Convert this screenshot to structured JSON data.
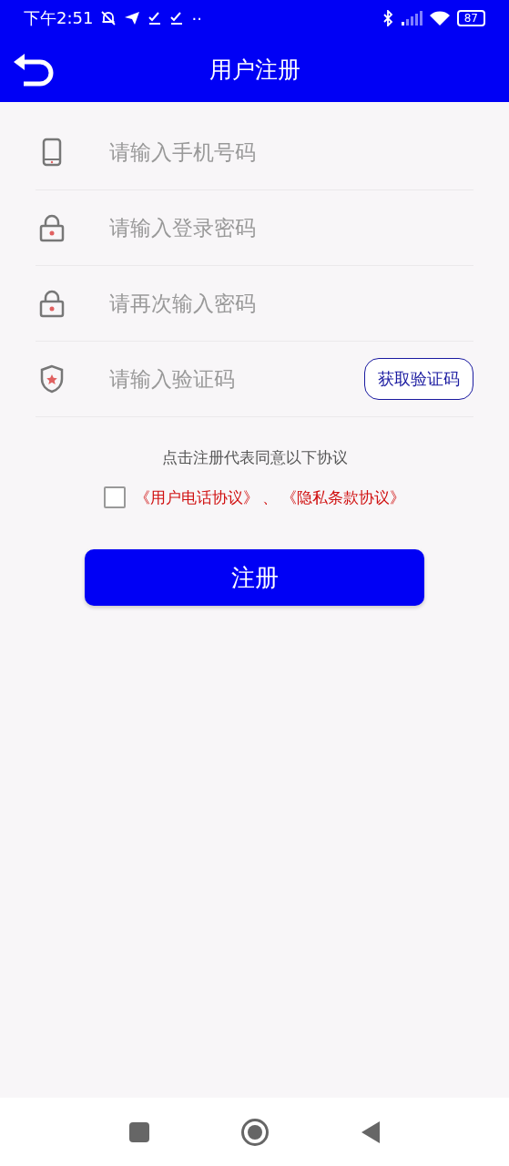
{
  "status_bar": {
    "time": "下午2:51",
    "dots": "··",
    "battery": "87"
  },
  "header": {
    "title": "用户注册"
  },
  "fields": [
    {
      "kind": "phone",
      "placeholder": "请输入手机号码"
    },
    {
      "kind": "lock",
      "placeholder": "请输入登录密码"
    },
    {
      "kind": "lock",
      "placeholder": "请再次输入密码"
    },
    {
      "kind": "shield",
      "placeholder": "请输入验证码",
      "button": "获取验证码"
    }
  ],
  "notice": "点击注册代表同意以下协议",
  "agreement": {
    "checked": false,
    "links": [
      "《用户电话协议》",
      "《隐私条款协议》"
    ],
    "separator": "、"
  },
  "submit": "注册"
}
